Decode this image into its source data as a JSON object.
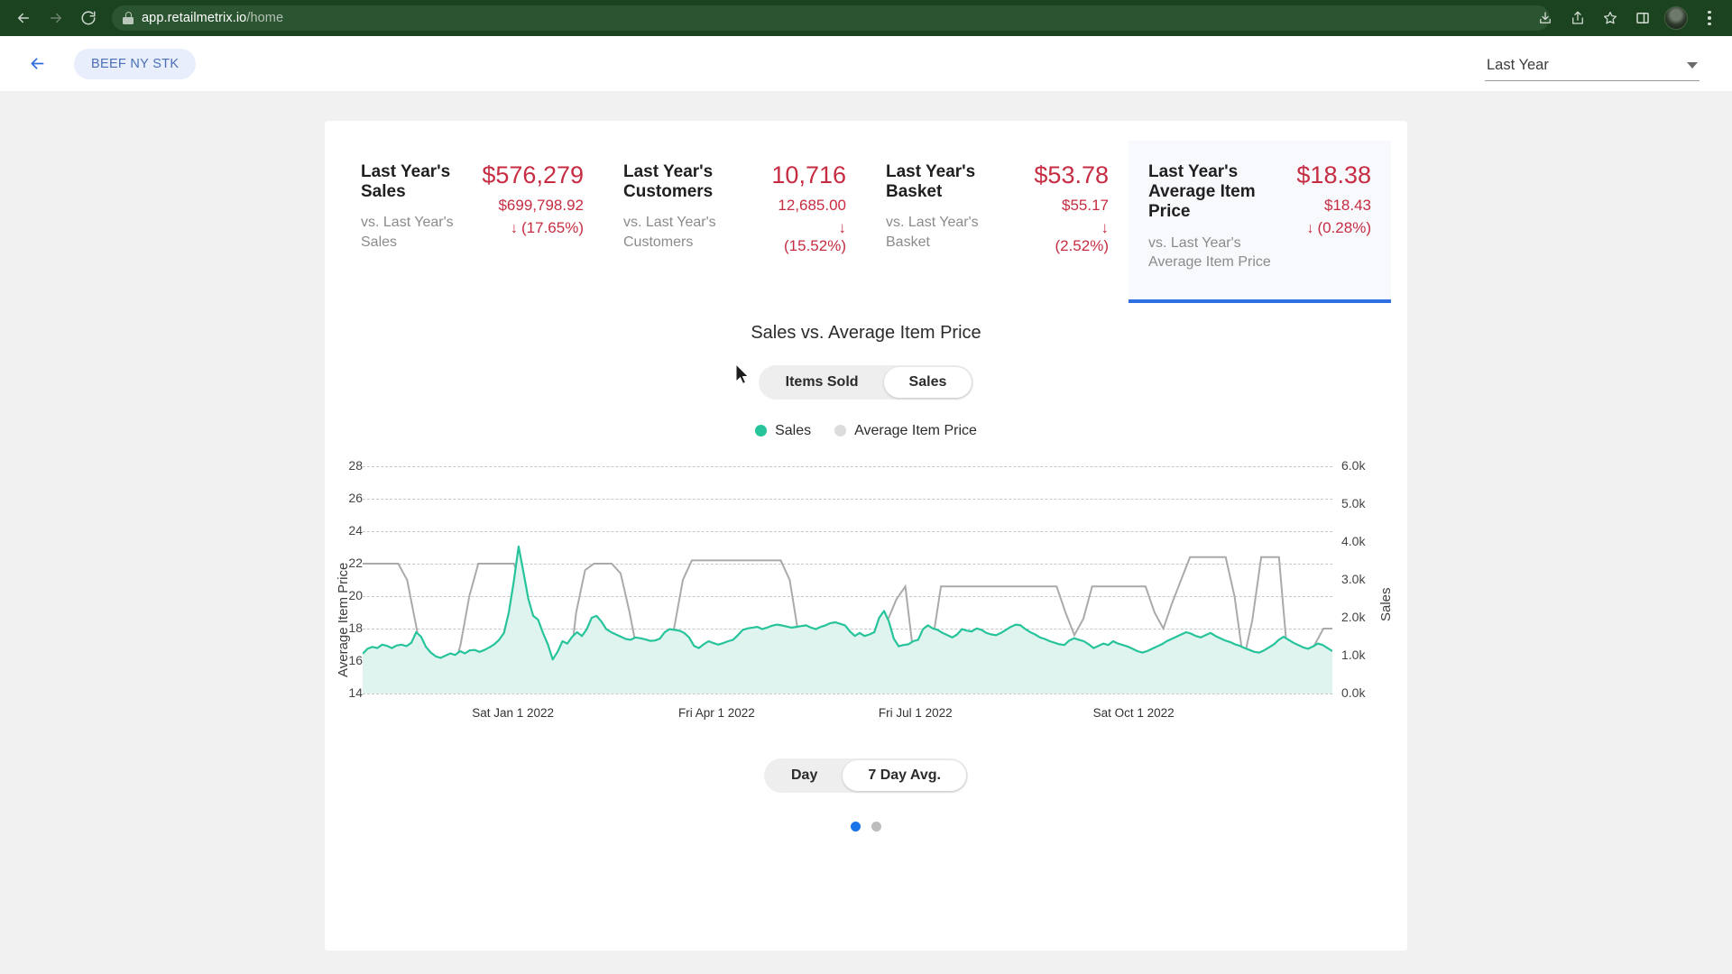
{
  "browser": {
    "url_host": "app.retailmetrix.io",
    "url_path": "/home",
    "back_label": "Back",
    "forward_label": "Forward",
    "reload_label": "Reload",
    "lock_icon": "lock-icon",
    "download_icon": "download-icon",
    "share_icon": "share-icon",
    "bookmark_icon": "star-icon",
    "sidepanel_icon": "side-panel-icon",
    "avatar_label": "Profile",
    "menu_icon": "three-dot-menu-icon",
    "theme_color": "#1b4320"
  },
  "header": {
    "back_label": "Back",
    "chip_label": "BEEF NY STK",
    "period_value": "Last Year",
    "period_options": [
      "Last Year"
    ]
  },
  "kpis": [
    {
      "title": "Last Year's Sales",
      "subtitle": "vs. Last Year's Sales",
      "value": "$576,279",
      "previous": "$699,798.92",
      "arrow": "↓",
      "delta": "(17.65%)",
      "selected": false
    },
    {
      "title": "Last Year's Customers",
      "subtitle": "vs. Last Year's Customers",
      "value": "10,716",
      "previous": "12,685.00",
      "arrow": "↓",
      "delta": "(15.52%)",
      "selected": false
    },
    {
      "title": "Last Year's Basket",
      "subtitle": "vs. Last Year's Basket",
      "value": "$53.78",
      "previous": "$55.17",
      "arrow": "↓",
      "delta": "(2.52%)",
      "selected": false
    },
    {
      "title": "Last Year's Average Item Price",
      "subtitle": "vs. Last Year's Average Item Price",
      "value": "$18.38",
      "previous": "$18.43",
      "arrow": "↓",
      "delta": "(0.28%)",
      "selected": true
    }
  ],
  "chart_section": {
    "title": "Sales vs. Average Item Price",
    "metric_toggle": {
      "options": [
        "Items Sold",
        "Sales"
      ],
      "selected": "Sales"
    },
    "granularity_toggle": {
      "options": [
        "Day",
        "7 Day Avg."
      ],
      "selected": "7 Day Avg."
    },
    "pagination": {
      "count": 2,
      "active_index": 0
    }
  },
  "chart_data": {
    "type": "line",
    "title": "Sales vs. Average Item Price",
    "xlabel": "",
    "x_tick_labels": [
      "Sat Jan 1 2022",
      "Fri Apr 1 2022",
      "Fri Jul 1 2022",
      "Sat Oct 1 2022"
    ],
    "x_tick_positions_pct": [
      15.5,
      36.5,
      57.0,
      79.5
    ],
    "grid": true,
    "legend_position": "top-center",
    "axes": [
      {
        "id": "left",
        "label": "Average Item Price",
        "ticks": [
          14,
          16,
          18,
          20,
          22,
          24,
          26,
          28
        ],
        "ylim": [
          14,
          28
        ],
        "tick_labels": [
          "14",
          "16",
          "18",
          "20",
          "22",
          "24",
          "26",
          "28"
        ]
      },
      {
        "id": "right",
        "label": "Sales",
        "ticks": [
          0,
          1000,
          2000,
          3000,
          4000,
          5000,
          6000
        ],
        "ylim": [
          0,
          6000
        ],
        "tick_labels": [
          "0.0k",
          "1.0k",
          "2.0k",
          "3.0k",
          "4.0k",
          "5.0k",
          "6.0k"
        ]
      }
    ],
    "series": [
      {
        "name": "Sales",
        "axis": "right",
        "color": "#27c49b",
        "fill": "#dff4ee",
        "type": "area",
        "values": [
          1050,
          1180,
          1230,
          1200,
          1290,
          1260,
          1200,
          1270,
          1290,
          1250,
          1340,
          1620,
          1500,
          1230,
          1080,
          980,
          940,
          1000,
          1060,
          1020,
          1120,
          1060,
          1140,
          1150,
          1100,
          1150,
          1220,
          1300,
          1420,
          1600,
          2150,
          2950,
          3880,
          3200,
          2500,
          2050,
          1950,
          1600,
          1300,
          900,
          1100,
          1380,
          1320,
          1500,
          1620,
          1520,
          1700,
          2000,
          2050,
          1900,
          1700,
          1620,
          1560,
          1500,
          1440,
          1420,
          1480,
          1460,
          1430,
          1390,
          1400,
          1450,
          1620,
          1700,
          1680,
          1660,
          1600,
          1480,
          1260,
          1200,
          1300,
          1380,
          1330,
          1290,
          1330,
          1380,
          1420,
          1540,
          1680,
          1720,
          1740,
          1760,
          1700,
          1740,
          1790,
          1820,
          1800,
          1770,
          1740,
          1760,
          1780,
          1800,
          1740,
          1700,
          1760,
          1800,
          1860,
          1880,
          1840,
          1800,
          1640,
          1520,
          1600,
          1520,
          1560,
          1620,
          2000,
          2180,
          1900,
          1450,
          1250,
          1280,
          1300,
          1380,
          1420,
          1700,
          1800,
          1720,
          1680,
          1600,
          1540,
          1480,
          1560,
          1700,
          1660,
          1640,
          1720,
          1680,
          1600,
          1560,
          1540,
          1600,
          1680,
          1760,
          1820,
          1800,
          1700,
          1620,
          1560,
          1480,
          1440,
          1380,
          1340,
          1300,
          1280,
          1400,
          1460,
          1420,
          1380,
          1300,
          1200,
          1260,
          1320,
          1280,
          1380,
          1320,
          1280,
          1240,
          1180,
          1120,
          1080,
          1120,
          1180,
          1240,
          1300,
          1380,
          1440,
          1500,
          1560,
          1620,
          1580,
          1520,
          1480,
          1540,
          1600,
          1520,
          1460,
          1400,
          1360,
          1300,
          1260,
          1200,
          1150,
          1100,
          1080,
          1140,
          1220,
          1300,
          1420,
          1500,
          1420,
          1340,
          1280,
          1220,
          1180,
          1240,
          1320,
          1280,
          1200,
          1120
        ]
      },
      {
        "name": "Average Item Price",
        "axis": "left",
        "color": "#aaaaaa",
        "type": "step",
        "values": [
          22.0,
          22.0,
          22.0,
          22.0,
          22.0,
          21.0,
          18.2,
          15.2,
          15.0,
          15.0,
          15.0,
          17.0,
          20.0,
          22.0,
          22.0,
          22.0,
          22.0,
          22.0,
          20.5,
          17.8,
          15.0,
          14.2,
          14.2,
          14.2,
          19.0,
          21.6,
          22.0,
          22.0,
          22.0,
          21.4,
          19.0,
          16.2,
          14.2,
          14.2,
          14.2,
          18.0,
          21.0,
          22.2,
          22.2,
          22.2,
          22.2,
          22.2,
          22.2,
          22.2,
          22.2,
          22.2,
          22.2,
          22.2,
          21.0,
          17.6,
          15.0,
          15.0,
          15.0,
          16.0,
          17.0,
          17.0,
          17.0,
          17.2,
          17.8,
          18.5,
          19.8,
          20.6,
          16.0,
          14.0,
          17.0,
          20.6,
          20.6,
          20.6,
          20.6,
          20.6,
          20.6,
          20.6,
          20.6,
          20.6,
          20.6,
          20.6,
          20.6,
          20.6,
          20.6,
          19.0,
          17.6,
          18.6,
          20.6,
          20.6,
          20.6,
          20.6,
          20.6,
          20.6,
          20.6,
          19.0,
          18.0,
          19.6,
          21.0,
          22.4,
          22.4,
          22.4,
          22.4,
          22.4,
          20.0,
          16.0,
          18.5,
          22.4,
          22.4,
          22.4,
          16.0,
          16.0,
          16.2,
          17.0,
          18.0,
          18.0
        ]
      }
    ]
  },
  "colors": {
    "accent_blue": "#2f6fe0",
    "negative_red": "#c62d42",
    "sales_teal": "#27c49b",
    "price_gray": "#aaaaaa",
    "browser_green": "#1b4320"
  }
}
